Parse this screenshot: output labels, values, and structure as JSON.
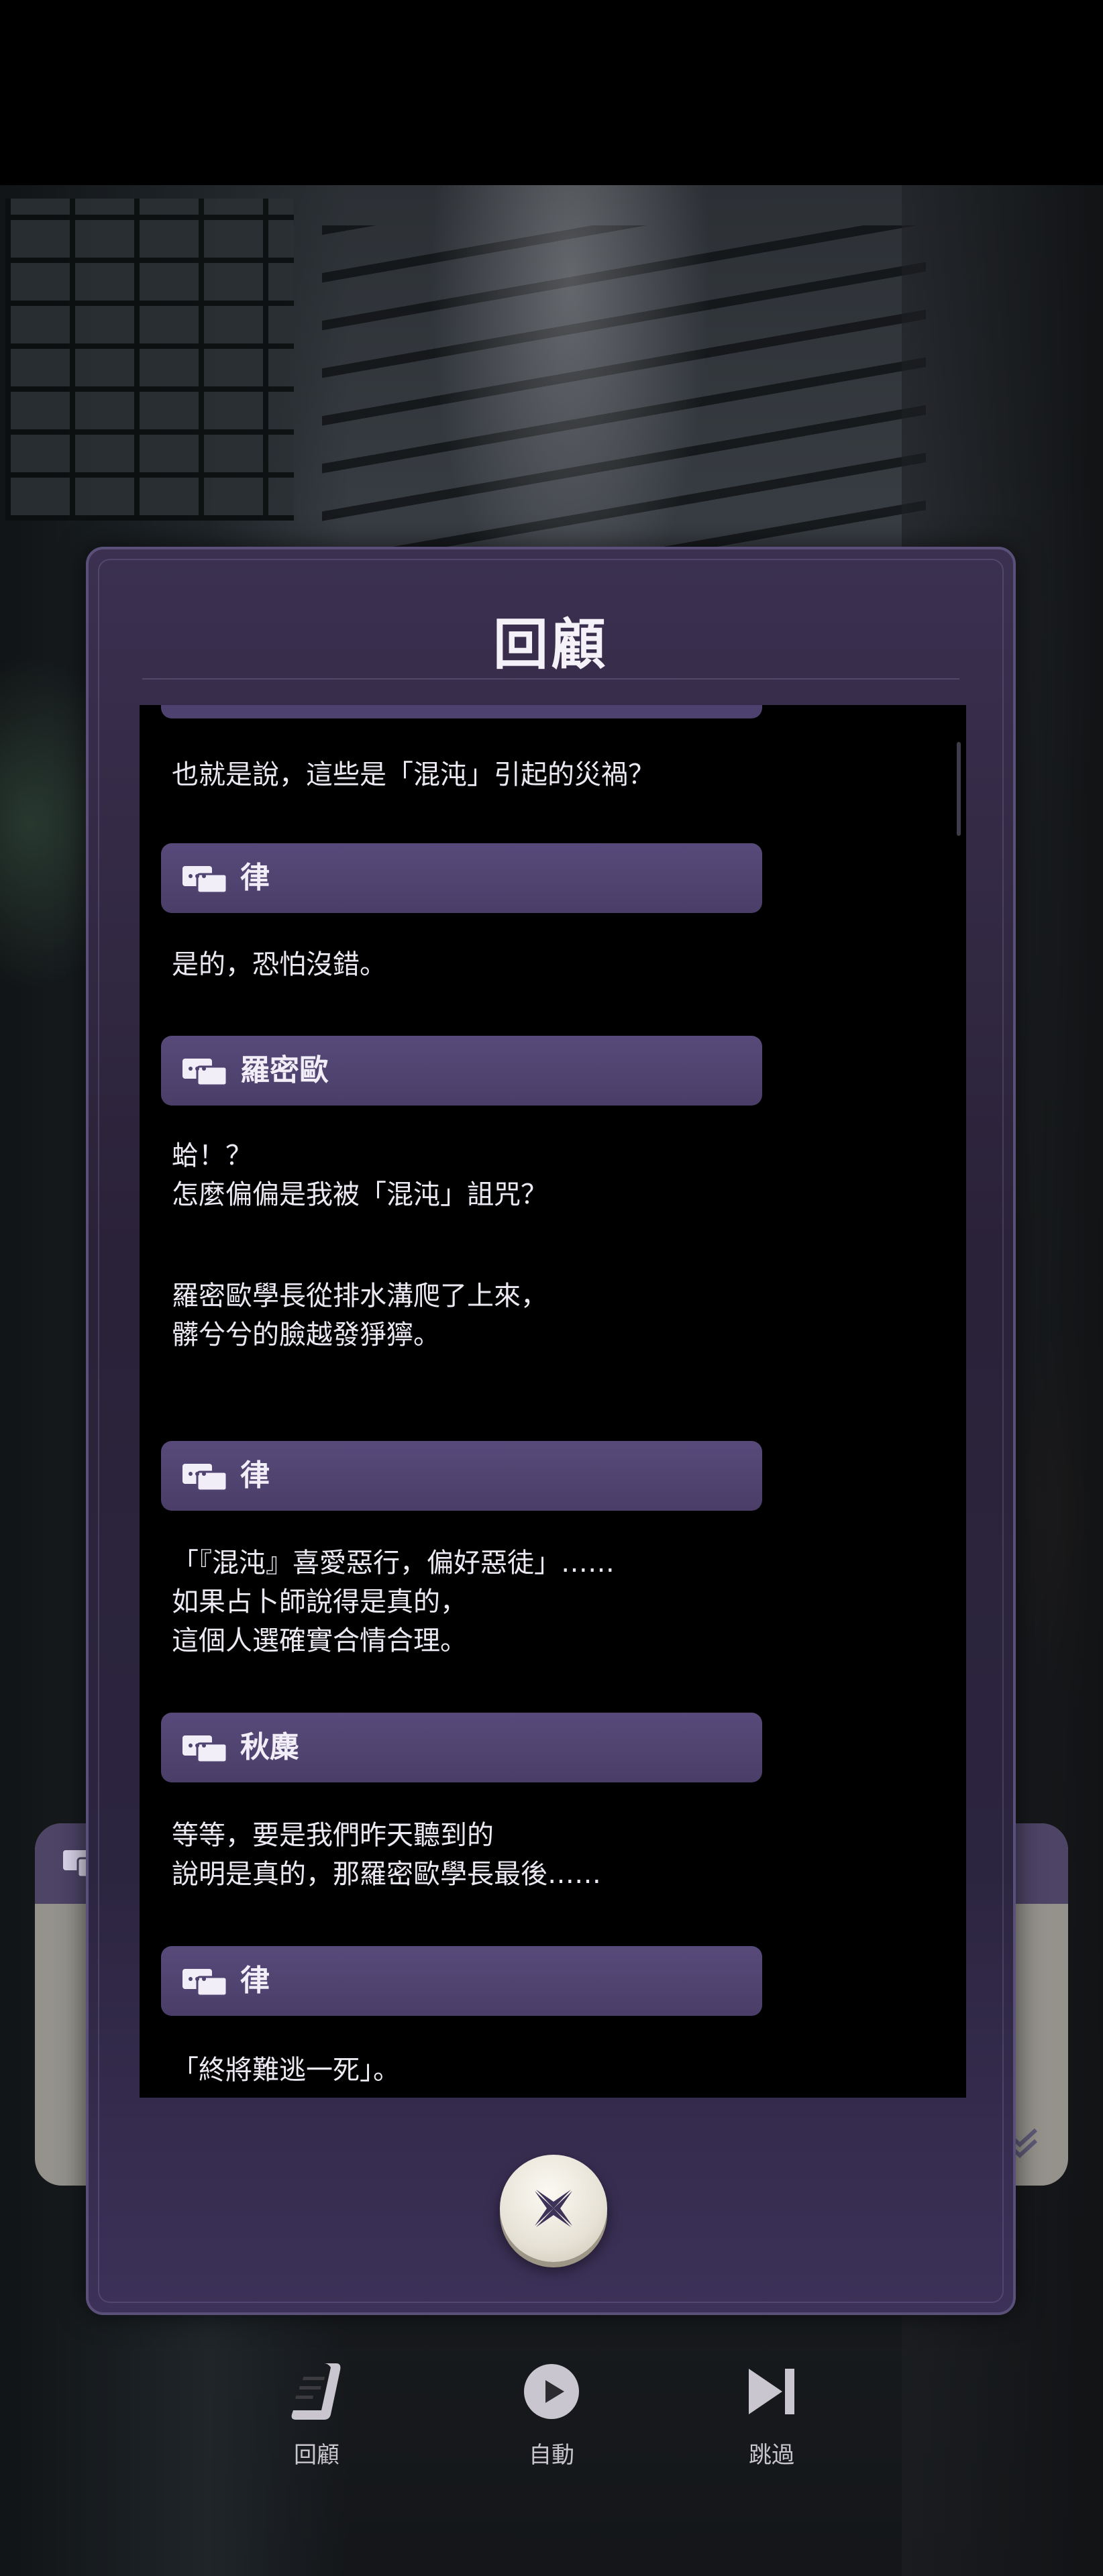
{
  "modal": {
    "title": "回顧",
    "close_icon": "close-x-icon"
  },
  "log": {
    "first_line": "也就是說，這些是「混沌」引起的災禍？",
    "entries": [
      {
        "speaker": "律",
        "lines": [
          "是的，恐怕沒錯。"
        ]
      },
      {
        "speaker": "羅密歐",
        "lines": [
          "蛤！？",
          "怎麼偏偏是我被「混沌」詛咒？"
        ]
      },
      {
        "narration": [
          "羅密歐學長從排水溝爬了上來，",
          "髒兮兮的臉越發猙獰。"
        ]
      },
      {
        "speaker": "律",
        "lines": [
          "「『混沌』喜愛惡行，偏好惡徒」……",
          "如果占卜師說得是真的，",
          "這個人選確實合情合理。"
        ]
      },
      {
        "speaker": "秋麋",
        "lines": [
          "等等，要是我們昨天聽到的",
          "說明是真的，那羅密歐學長最後……"
        ]
      },
      {
        "speaker": "律",
        "lines": [
          "「終將難逃一死」。"
        ]
      }
    ]
  },
  "menu": {
    "review": {
      "label": "回顧",
      "icon": "scroll-icon"
    },
    "auto": {
      "label": "自動",
      "icon": "play-icon"
    },
    "skip": {
      "label": "跳過",
      "icon": "skip-icon"
    }
  },
  "colors": {
    "modal_bg": "#2a2238",
    "speaker_bar": "#4f436f",
    "log_bg": "#000000",
    "text": "#ece9f2"
  }
}
